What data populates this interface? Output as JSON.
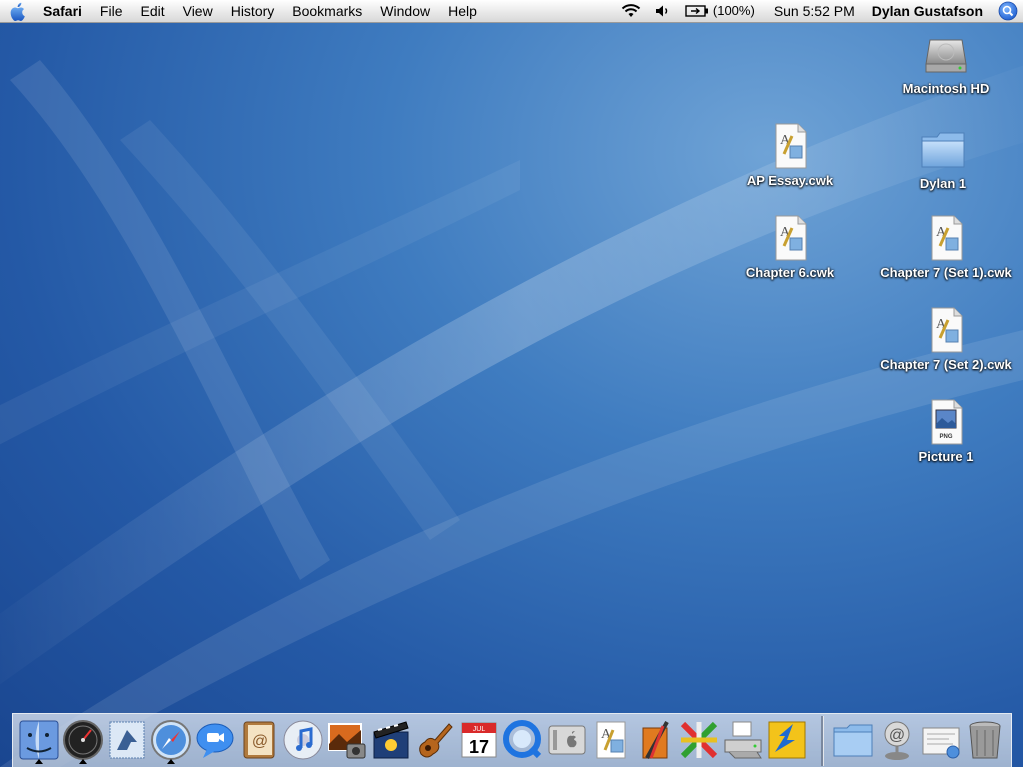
{
  "menubar": {
    "app_name": "Safari",
    "menus": [
      "File",
      "Edit",
      "View",
      "History",
      "Bookmarks",
      "Window",
      "Help"
    ],
    "battery": "(100%)",
    "clock": "Sun 5:52 PM",
    "user": "Dylan Gustafson"
  },
  "desktop": {
    "icons": [
      {
        "label": "Macintosh HD",
        "icon": "hard-drive-icon"
      },
      {
        "label": "AP Essay.cwk",
        "icon": "appleworks-document-icon"
      },
      {
        "label": "Dylan 1",
        "icon": "folder-icon"
      },
      {
        "label": "Chapter 6.cwk",
        "icon": "appleworks-document-icon"
      },
      {
        "label": "Chapter 7 (Set 1).cwk",
        "icon": "appleworks-document-icon"
      },
      {
        "label": "Chapter 7 (Set 2).cwk",
        "icon": "appleworks-document-icon"
      },
      {
        "label": "Picture 1",
        "icon": "png-image-icon"
      }
    ],
    "png_badge": "PNG"
  },
  "dock": {
    "ical_day": "17",
    "ical_month": "JUL",
    "apps": [
      {
        "name": "finder-icon",
        "running": true
      },
      {
        "name": "dashboard-icon",
        "running": true
      },
      {
        "name": "mail-icon",
        "running": false
      },
      {
        "name": "safari-icon",
        "running": true
      },
      {
        "name": "ichat-icon",
        "running": false
      },
      {
        "name": "address-book-icon",
        "running": false
      },
      {
        "name": "itunes-icon",
        "running": false
      },
      {
        "name": "iphoto-icon",
        "running": false
      },
      {
        "name": "imovie-icon",
        "running": false
      },
      {
        "name": "garageband-icon",
        "running": false
      },
      {
        "name": "ical-icon",
        "running": false
      },
      {
        "name": "quicktime-icon",
        "running": false
      },
      {
        "name": "system-preferences-icon",
        "running": false
      },
      {
        "name": "appleworks-icon",
        "running": false
      },
      {
        "name": "art-tool-icon",
        "running": false
      },
      {
        "name": "crossover-icon",
        "running": false
      },
      {
        "name": "printer-icon",
        "running": false
      },
      {
        "name": "utility-app-icon",
        "running": false
      }
    ],
    "others": [
      {
        "name": "applications-folder-icon"
      },
      {
        "name": "network-icon"
      },
      {
        "name": "mail-document-icon"
      },
      {
        "name": "trash-icon"
      }
    ]
  }
}
